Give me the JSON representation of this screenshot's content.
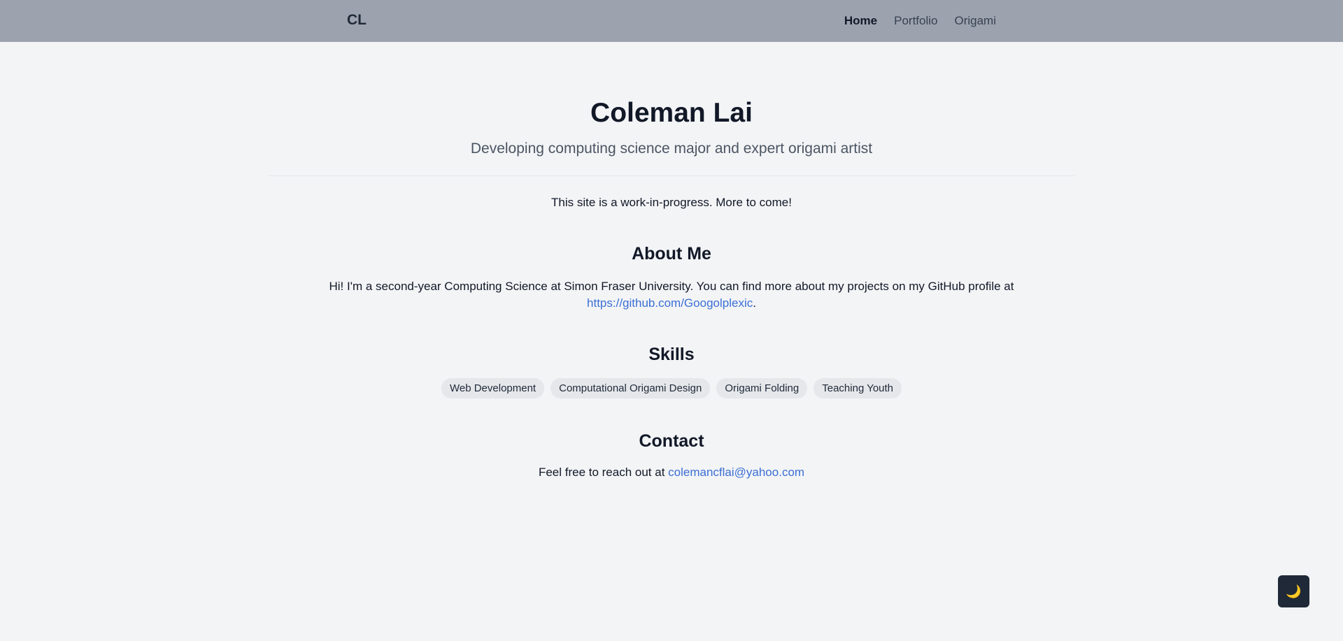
{
  "nav": {
    "brand": "CL",
    "links": [
      {
        "label": "Home",
        "active": true
      },
      {
        "label": "Portfolio",
        "active": false
      },
      {
        "label": "Origami",
        "active": false
      }
    ]
  },
  "hero": {
    "title": "Coleman Lai",
    "subtitle": "Developing computing science major and expert origami artist"
  },
  "notice": "This site is a work-in-progress. More to come!",
  "about": {
    "title": "About Me",
    "text_before": "Hi! I'm a second-year Computing Science at Simon Fraser University. You can find more about my projects on my GitHub profile at ",
    "link": "https://github.com/Googolplexic",
    "text_after": "."
  },
  "skills": {
    "title": "Skills",
    "items": [
      "Web Development",
      "Computational Origami Design",
      "Origami Folding",
      "Teaching Youth"
    ]
  },
  "contact": {
    "title": "Contact",
    "text": "Feel free to reach out at ",
    "email": "colemancflai@yahoo.com"
  },
  "theme_toggle": {
    "icon": "moon-icon",
    "glyph": "🌙"
  },
  "colors": {
    "navbar": "#9ca3af",
    "background": "#f3f4f6",
    "link": "#3b6fd4",
    "chip": "#e5e7eb",
    "toggle": "#1f2937"
  }
}
